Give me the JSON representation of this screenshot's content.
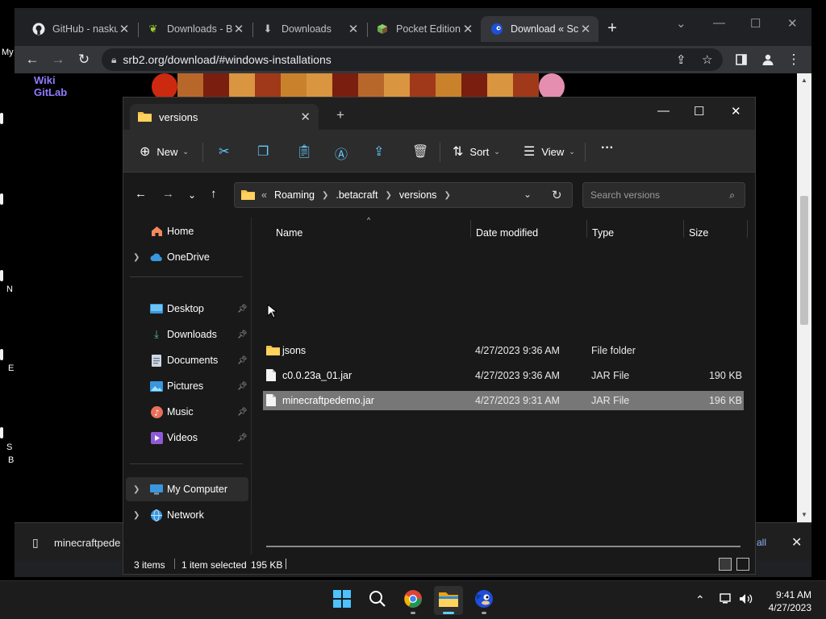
{
  "desktop": {
    "labels": [
      "My",
      "N",
      "E",
      "S",
      "B"
    ]
  },
  "browser": {
    "tabs": [
      {
        "label": "GitHub - nasku",
        "icon": "github-icon"
      },
      {
        "label": "Downloads - B",
        "icon": "leaf-icon"
      },
      {
        "label": "Downloads",
        "icon": "download-icon"
      },
      {
        "label": "Pocket Edition",
        "icon": "cube-icon"
      },
      {
        "label": "Download « Sc",
        "icon": "sonic-icon"
      }
    ],
    "url": "srb2.org/download/#windows-installations",
    "page_links": [
      "Wiki",
      "GitLab"
    ],
    "download_item": "minecraftpede",
    "show_all": "all"
  },
  "explorer": {
    "tab_title": "versions",
    "commands": {
      "new": "New",
      "sort": "Sort",
      "view": "View",
      "more": "···"
    },
    "address": {
      "overflow": "«",
      "parts": [
        "Roaming",
        ".betacraft",
        "versions"
      ]
    },
    "search_placeholder": "Search versions",
    "sidebar": {
      "home": "Home",
      "onedrive": "OneDrive",
      "desktop": "Desktop",
      "downloads": "Downloads",
      "documents": "Documents",
      "pictures": "Pictures",
      "music": "Music",
      "videos": "Videos",
      "my_computer": "My Computer",
      "network": "Network"
    },
    "columns": {
      "name": "Name",
      "date": "Date modified",
      "type": "Type",
      "size": "Size"
    },
    "files": [
      {
        "name": "jsons",
        "date": "4/27/2023 9:36 AM",
        "type": "File folder",
        "size": "",
        "kind": "folder"
      },
      {
        "name": "c0.0.23a_01.jar",
        "date": "4/27/2023 9:36 AM",
        "type": "JAR File",
        "size": "190 KB",
        "kind": "file"
      },
      {
        "name": "minecraftpedemo.jar",
        "date": "4/27/2023 9:31 AM",
        "type": "JAR File",
        "size": "196 KB",
        "kind": "file"
      }
    ],
    "status": {
      "items": "3 items",
      "selected": "1 item selected",
      "selected_size": "195 KB"
    }
  },
  "taskbar": {
    "time": "9:41 AM",
    "date": "4/27/2023"
  },
  "colors": {
    "accent": "#60cdff",
    "folder": "#f4c04e",
    "chrome_bg": "#202124",
    "explorer_bg": "#191919"
  }
}
